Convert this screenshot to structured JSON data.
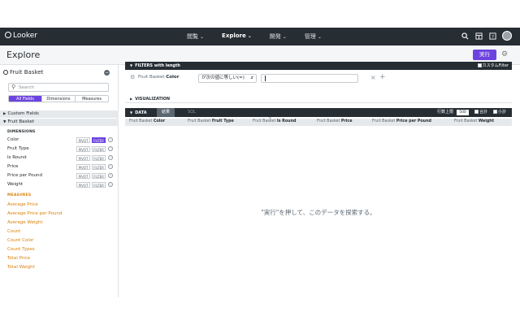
{
  "nav": {
    "logo": "Looker",
    "items": [
      {
        "label": "閲覧",
        "active": false
      },
      {
        "label": "Explore",
        "active": true
      },
      {
        "label": "開発",
        "active": false
      },
      {
        "label": "管理",
        "active": false
      }
    ],
    "icons": [
      "search-icon",
      "marketplace-icon",
      "help-icon",
      "user-avatar"
    ]
  },
  "header": {
    "title": "Explore",
    "run_label": "実行",
    "settings_icon": "gear-icon"
  },
  "sidebar": {
    "model_title": "Fruit Basket",
    "search_placeholder": "Search",
    "tabs": [
      "All Fields",
      "Dimensions",
      "Measures"
    ],
    "active_tab": "All Fields",
    "groups": [
      {
        "label": "Custom Fields",
        "collapsed": true
      },
      {
        "label": "Fruit Basket",
        "collapsed": false
      }
    ],
    "dimensions_title": "DIMENSIONS",
    "pivot_label": "PIVOT",
    "filter_label": "FILTER",
    "dimensions": [
      {
        "label": "Color",
        "filter_active": true
      },
      {
        "label": "Fruit Type",
        "filter_active": false
      },
      {
        "label": "Is Round",
        "filter_active": false
      },
      {
        "label": "Price",
        "filter_active": false
      },
      {
        "label": "Price per Pound",
        "filter_active": false
      },
      {
        "label": "Weight",
        "filter_active": false
      }
    ],
    "measures_title": "MEASURES",
    "measures": [
      "Average Price",
      "Average Price per Pound",
      "Average Weight",
      "Count",
      "Count Color",
      "Count Types",
      "Total Price",
      "Total Weight"
    ]
  },
  "filters": {
    "bar_title": "FILTERS with length",
    "custom_filter_label": "カスタムFilter",
    "row": {
      "field_prefix": "Fruit Basket ",
      "field_name": "Color",
      "operator": "が次の値に等しい(=)",
      "value": ""
    }
  },
  "visualization": {
    "label": "VISUALIZATION"
  },
  "data": {
    "label": "DATA",
    "tabs": [
      "結果",
      "SQL"
    ],
    "row_limit_label": "行数上限",
    "row_limit": "500",
    "totals_label": "合計",
    "subtotals_label": "小計",
    "columns": [
      {
        "prefix": "Fruit Basket ",
        "name": "Color"
      },
      {
        "prefix": "Fruit Basket ",
        "name": "Fruit Type"
      },
      {
        "prefix": "Fruit Basket ",
        "name": "Is Round"
      },
      {
        "prefix": "Fruit Basket ",
        "name": "Price"
      },
      {
        "prefix": "Fruit Basket ",
        "name": "Price per Pound"
      },
      {
        "prefix": "Fruit Basket ",
        "name": "Weight"
      }
    ],
    "empty_message": "\"実行\"を押して、このデータを探索する。"
  },
  "colors": {
    "accent": "#6c43e0",
    "nav_bg": "#262d33",
    "measure": "#d8820e"
  }
}
